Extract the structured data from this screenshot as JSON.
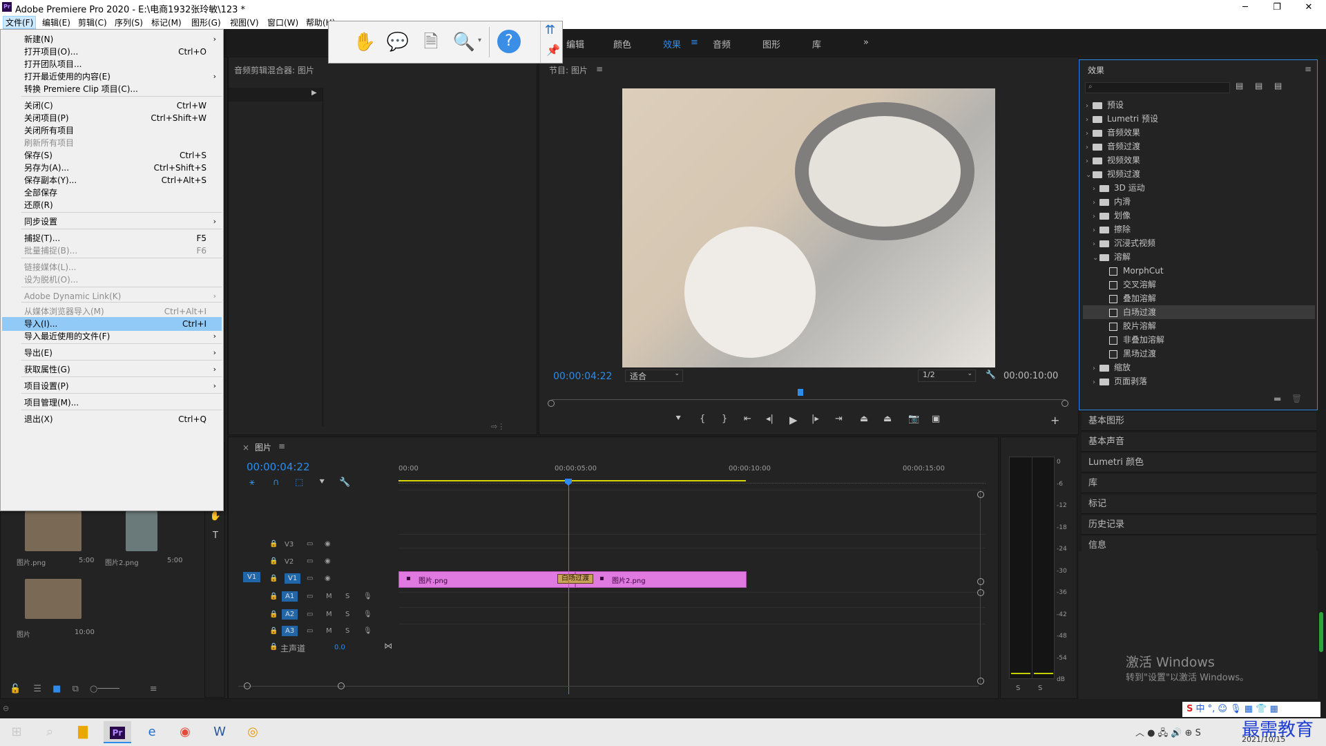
{
  "app": {
    "title": "Adobe Premiere Pro 2020 - E:\\电商1932张玲敏\\123 *",
    "logo": "Pr"
  },
  "menubar": [
    "文件(F)",
    "编辑(E)",
    "剪辑(C)",
    "序列(S)",
    "标记(M)",
    "图形(G)",
    "视图(V)",
    "窗口(W)",
    "帮助(H)"
  ],
  "workspaces": [
    "编辑",
    "颜色",
    "效果",
    "音频",
    "图形",
    "库"
  ],
  "file_menu": [
    {
      "label": "新建(N)",
      "shortcut": "",
      "sub": true,
      "disabled": false
    },
    {
      "label": "打开项目(O)...",
      "shortcut": "Ctrl+O",
      "sub": false,
      "disabled": false
    },
    {
      "label": "打开团队项目...",
      "shortcut": "",
      "sub": false,
      "disabled": false
    },
    {
      "label": "打开最近使用的内容(E)",
      "shortcut": "",
      "sub": true,
      "disabled": false
    },
    {
      "label": "转换 Premiere Clip 项目(C)...",
      "shortcut": "",
      "sub": false,
      "disabled": false
    },
    {
      "label": "关闭(C)",
      "shortcut": "Ctrl+W",
      "sub": false,
      "disabled": false
    },
    {
      "label": "关闭项目(P)",
      "shortcut": "Ctrl+Shift+W",
      "sub": false,
      "disabled": false
    },
    {
      "label": "关闭所有项目",
      "shortcut": "",
      "sub": false,
      "disabled": false
    },
    {
      "label": "刷新所有项目",
      "shortcut": "",
      "sub": false,
      "disabled": true
    },
    {
      "label": "保存(S)",
      "shortcut": "Ctrl+S",
      "sub": false,
      "disabled": false
    },
    {
      "label": "另存为(A)...",
      "shortcut": "Ctrl+Shift+S",
      "sub": false,
      "disabled": false
    },
    {
      "label": "保存副本(Y)...",
      "shortcut": "Ctrl+Alt+S",
      "sub": false,
      "disabled": false
    },
    {
      "label": "全部保存",
      "shortcut": "",
      "sub": false,
      "disabled": false
    },
    {
      "label": "还原(R)",
      "shortcut": "",
      "sub": false,
      "disabled": false
    },
    {
      "label": "同步设置",
      "shortcut": "",
      "sub": true,
      "disabled": false
    },
    {
      "label": "捕捉(T)...",
      "shortcut": "F5",
      "sub": false,
      "disabled": false
    },
    {
      "label": "批量捕捉(B)...",
      "shortcut": "F6",
      "sub": false,
      "disabled": true
    },
    {
      "label": "链接媒体(L)...",
      "shortcut": "",
      "sub": false,
      "disabled": true
    },
    {
      "label": "设为脱机(O)...",
      "shortcut": "",
      "sub": false,
      "disabled": true
    },
    {
      "label": "Adobe Dynamic Link(K)",
      "shortcut": "",
      "sub": true,
      "disabled": true
    },
    {
      "label": "从媒体浏览器导入(M)",
      "shortcut": "Ctrl+Alt+I",
      "sub": false,
      "disabled": true
    },
    {
      "label": "导入(I)...",
      "shortcut": "Ctrl+I",
      "sub": false,
      "disabled": false,
      "highlight": true
    },
    {
      "label": "导入最近使用的文件(F)",
      "shortcut": "",
      "sub": true,
      "disabled": false
    },
    {
      "label": "导出(E)",
      "shortcut": "",
      "sub": true,
      "disabled": false
    },
    {
      "label": "获取属性(G)",
      "shortcut": "",
      "sub": true,
      "disabled": false
    },
    {
      "label": "项目设置(P)",
      "shortcut": "",
      "sub": true,
      "disabled": false
    },
    {
      "label": "项目管理(M)...",
      "shortcut": "",
      "sub": false,
      "disabled": false
    },
    {
      "label": "退出(X)",
      "shortcut": "Ctrl+Q",
      "sub": false,
      "disabled": false
    }
  ],
  "audio_mixer": {
    "title": "音频剪辑混合器: 图片"
  },
  "program": {
    "title": "节目: 图片",
    "timecode": "00:00:04:22",
    "fit": "适合",
    "quality": "1/2",
    "duration": "00:00:10:00"
  },
  "effects": {
    "title": "效果",
    "tree": [
      {
        "label": "预设",
        "level": 0,
        "open": false,
        "type": "preset"
      },
      {
        "label": "Lumetri 预设",
        "level": 0,
        "open": false,
        "type": "preset"
      },
      {
        "label": "音频效果",
        "level": 0,
        "open": false,
        "type": "folder"
      },
      {
        "label": "音频过渡",
        "level": 0,
        "open": false,
        "type": "folder"
      },
      {
        "label": "视频效果",
        "level": 0,
        "open": false,
        "type": "folder"
      },
      {
        "label": "视频过渡",
        "level": 0,
        "open": true,
        "type": "folder"
      },
      {
        "label": "3D 运动",
        "level": 1,
        "open": false,
        "type": "folder"
      },
      {
        "label": "内滑",
        "level": 1,
        "open": false,
        "type": "folder"
      },
      {
        "label": "划像",
        "level": 1,
        "open": false,
        "type": "folder"
      },
      {
        "label": "擦除",
        "level": 1,
        "open": false,
        "type": "folder"
      },
      {
        "label": "沉浸式视频",
        "level": 1,
        "open": false,
        "type": "folder"
      },
      {
        "label": "溶解",
        "level": 1,
        "open": true,
        "type": "folder"
      },
      {
        "label": "MorphCut",
        "level": 2,
        "type": "fx"
      },
      {
        "label": "交叉溶解",
        "level": 2,
        "type": "fx"
      },
      {
        "label": "叠加溶解",
        "level": 2,
        "type": "fx"
      },
      {
        "label": "白场过渡",
        "level": 2,
        "type": "fx",
        "selected": true
      },
      {
        "label": "胶片溶解",
        "level": 2,
        "type": "fx"
      },
      {
        "label": "非叠加溶解",
        "level": 2,
        "type": "fx"
      },
      {
        "label": "黑场过渡",
        "level": 2,
        "type": "fx"
      },
      {
        "label": "缩放",
        "level": 1,
        "open": false,
        "type": "folder"
      },
      {
        "label": "页面剥落",
        "level": 1,
        "open": false,
        "type": "folder"
      }
    ]
  },
  "side_panels": [
    "基本图形",
    "基本声音",
    "Lumetri 颜色",
    "库",
    "标记",
    "历史记录",
    "信息"
  ],
  "project": {
    "items": [
      {
        "name": "图片.png",
        "dur": "5:00"
      },
      {
        "name": "图片2.png",
        "dur": "5:00"
      },
      {
        "name": "图片",
        "dur": "10:00"
      }
    ]
  },
  "timeline": {
    "title": "图片",
    "timecode": "00:00:04:22",
    "ruler": [
      "00:00",
      "00:00:05:00",
      "00:00:10:00",
      "00:00:15:00"
    ],
    "video_tracks": [
      "V3",
      "V2",
      "V1"
    ],
    "audio_tracks": [
      "A1",
      "A2",
      "A3"
    ],
    "source_v1": "V1",
    "master_label": "主声道",
    "master_value": "0.0",
    "clips": [
      {
        "name": "图片.png"
      },
      {
        "name": "图片2.png"
      }
    ],
    "transition": "白场过渡"
  },
  "meter": {
    "ticks": [
      "0",
      "-6",
      "-12",
      "-18",
      "-24",
      "-30",
      "-36",
      "-42",
      "-48",
      "-54",
      "dB"
    ],
    "solo": [
      "S",
      "S"
    ]
  },
  "watermark": {
    "line1": "激活 Windows",
    "line2": "转到\"设置\"以激活 Windows。"
  },
  "taskbar": {
    "date": "2021/10/15",
    "brand": "最需教育",
    "tray_ime": "中"
  }
}
